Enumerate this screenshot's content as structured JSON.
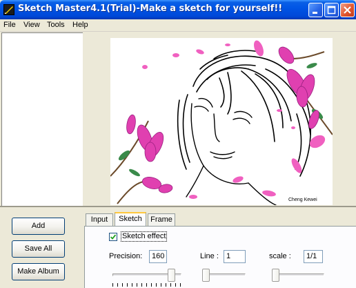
{
  "window": {
    "title": "Sketch Master4.1(Trial)-Make a sketch for yourself!!"
  },
  "menu": [
    "File",
    "View",
    "Tools",
    "Help"
  ],
  "sidebar_buttons": {
    "add": "Add",
    "save_all": "Save All",
    "make_album": "Make Album"
  },
  "tabs": [
    {
      "label": "Input",
      "active": false
    },
    {
      "label": "Sketch",
      "active": true
    },
    {
      "label": "Frame",
      "active": false
    }
  ],
  "sketch": {
    "effect_label": "Sketch effect",
    "effect_checked": true,
    "precision_label": "Precision:",
    "precision_value": "160",
    "line_label": "Line :",
    "line_value": "1",
    "scale_label": "scale :",
    "scale_value": "1/1"
  },
  "preview": {
    "watermark": "Cheng Kewei"
  },
  "colors": {
    "titlebar": "#0055e5",
    "flower_pink": "#e040b0",
    "petal_pink": "#f060c0",
    "branch_green": "#3a8a4a"
  }
}
